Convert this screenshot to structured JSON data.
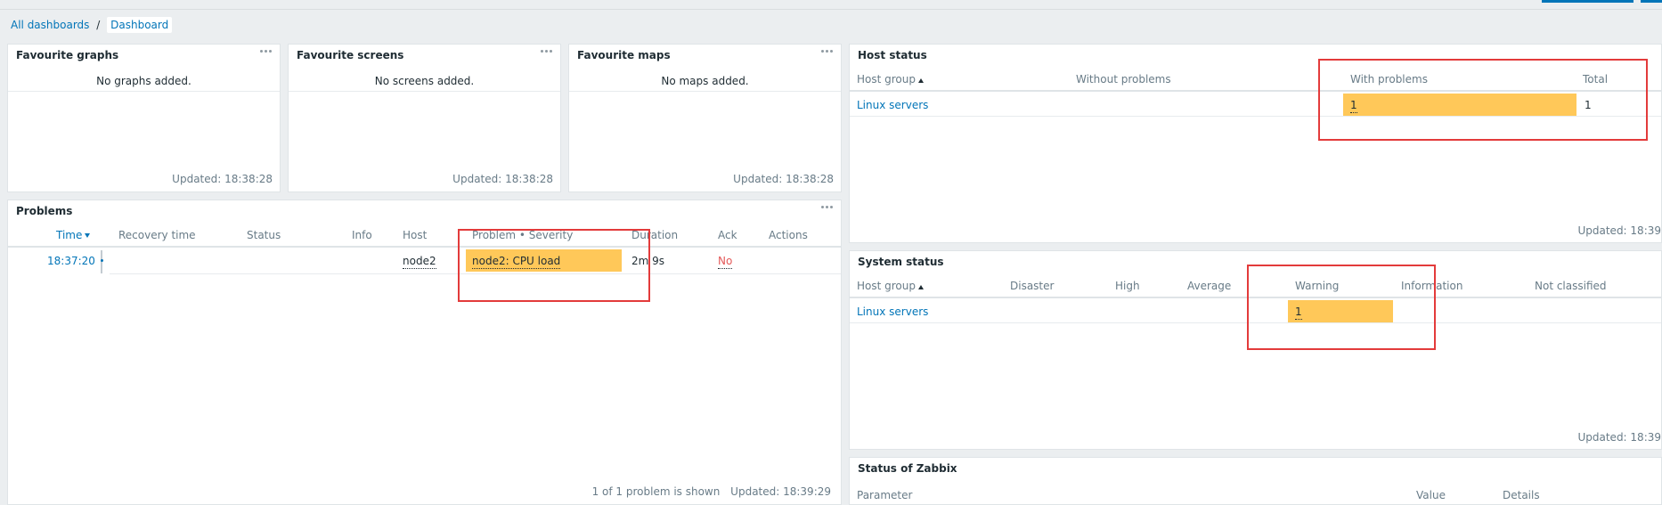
{
  "breadcrumb": {
    "all": "All dashboards",
    "sep": "/",
    "current": "Dashboard"
  },
  "fav_graphs": {
    "title": "Favourite graphs",
    "empty": "No graphs added.",
    "updated": "Updated: 18:38:28"
  },
  "fav_screens": {
    "title": "Favourite screens",
    "empty": "No screens added.",
    "updated": "Updated: 18:38:28"
  },
  "fav_maps": {
    "title": "Favourite maps",
    "empty": "No maps added.",
    "updated": "Updated: 18:38:28"
  },
  "problems": {
    "title": "Problems",
    "columns": {
      "time": "Time",
      "recovery": "Recovery time",
      "status": "Status",
      "info": "Info",
      "host": "Host",
      "problem": "Problem • Severity",
      "duration": "Duration",
      "ack": "Ack",
      "actions": "Actions"
    },
    "row": {
      "time": "18:37:20",
      "host": "node2",
      "problem": "node2: CPU load",
      "duration": "2m 9s",
      "ack": "No"
    },
    "footer_count": "1 of 1 problem is shown",
    "updated": "Updated: 18:39:29"
  },
  "host_status": {
    "title": "Host status",
    "columns": {
      "group": "Host group",
      "without": "Without problems",
      "with": "With problems",
      "total": "Total"
    },
    "row": {
      "group": "Linux servers",
      "with": "1",
      "total": "1"
    },
    "updated": "Updated: 18:39"
  },
  "system_status": {
    "title": "System status",
    "columns": {
      "group": "Host group",
      "disaster": "Disaster",
      "high": "High",
      "average": "Average",
      "warning": "Warning",
      "information": "Information",
      "not_classified": "Not classified"
    },
    "row": {
      "group": "Linux servers",
      "warning": "1"
    },
    "updated": "Updated: 18:39"
  },
  "zabbix_status": {
    "title": "Status of Zabbix",
    "columns": {
      "parameter": "Parameter",
      "value": "Value",
      "details": "Details"
    }
  },
  "colors": {
    "accent": "#0275b8",
    "warning": "#ffc859",
    "highlight": "#e33b3b"
  }
}
